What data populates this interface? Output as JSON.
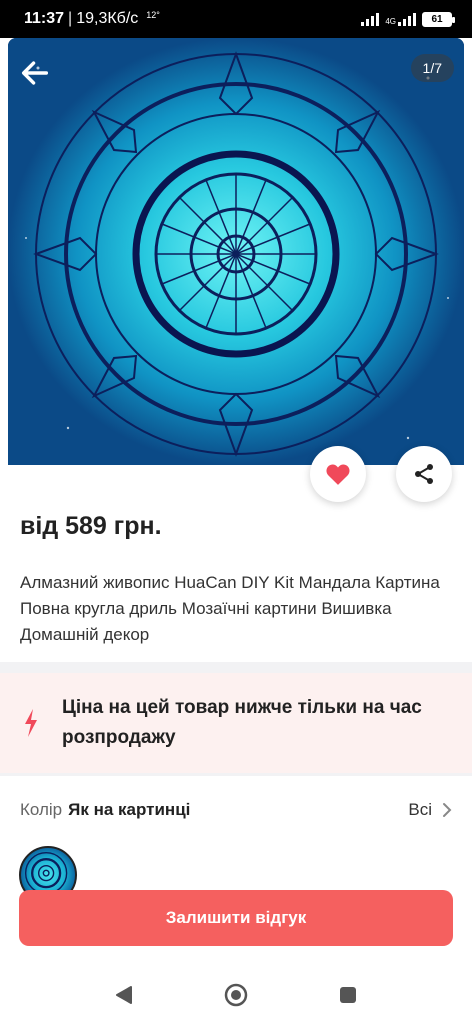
{
  "status_bar": {
    "time": "11:37",
    "speed": "19,3Кб/с",
    "extra": "12°",
    "network": "4G",
    "battery": "61"
  },
  "gallery": {
    "counter": "1/7",
    "icons": {
      "back": "arrow-left-icon",
      "favorite": "heart-icon",
      "share": "share-icon"
    }
  },
  "product": {
    "price": "від 589 грн.",
    "title": "Алмазний живопис HuaCan DIY Kit Мандала Картина Повна кругла дриль Мозаїчні картини Вишивка Домашній декор"
  },
  "sale_banner": {
    "icon": "lightning-icon",
    "text": "Ціна на цей товар нижче тільки на час розпродажу"
  },
  "color": {
    "label": "Колір",
    "value": "Як на картинці",
    "all_label": "Всі"
  },
  "actions": {
    "review_label": "Залишити відгук"
  },
  "colors": {
    "accent": "#f5605f",
    "heart": "#f0495a",
    "banner_bg": "#fdf1f0"
  }
}
